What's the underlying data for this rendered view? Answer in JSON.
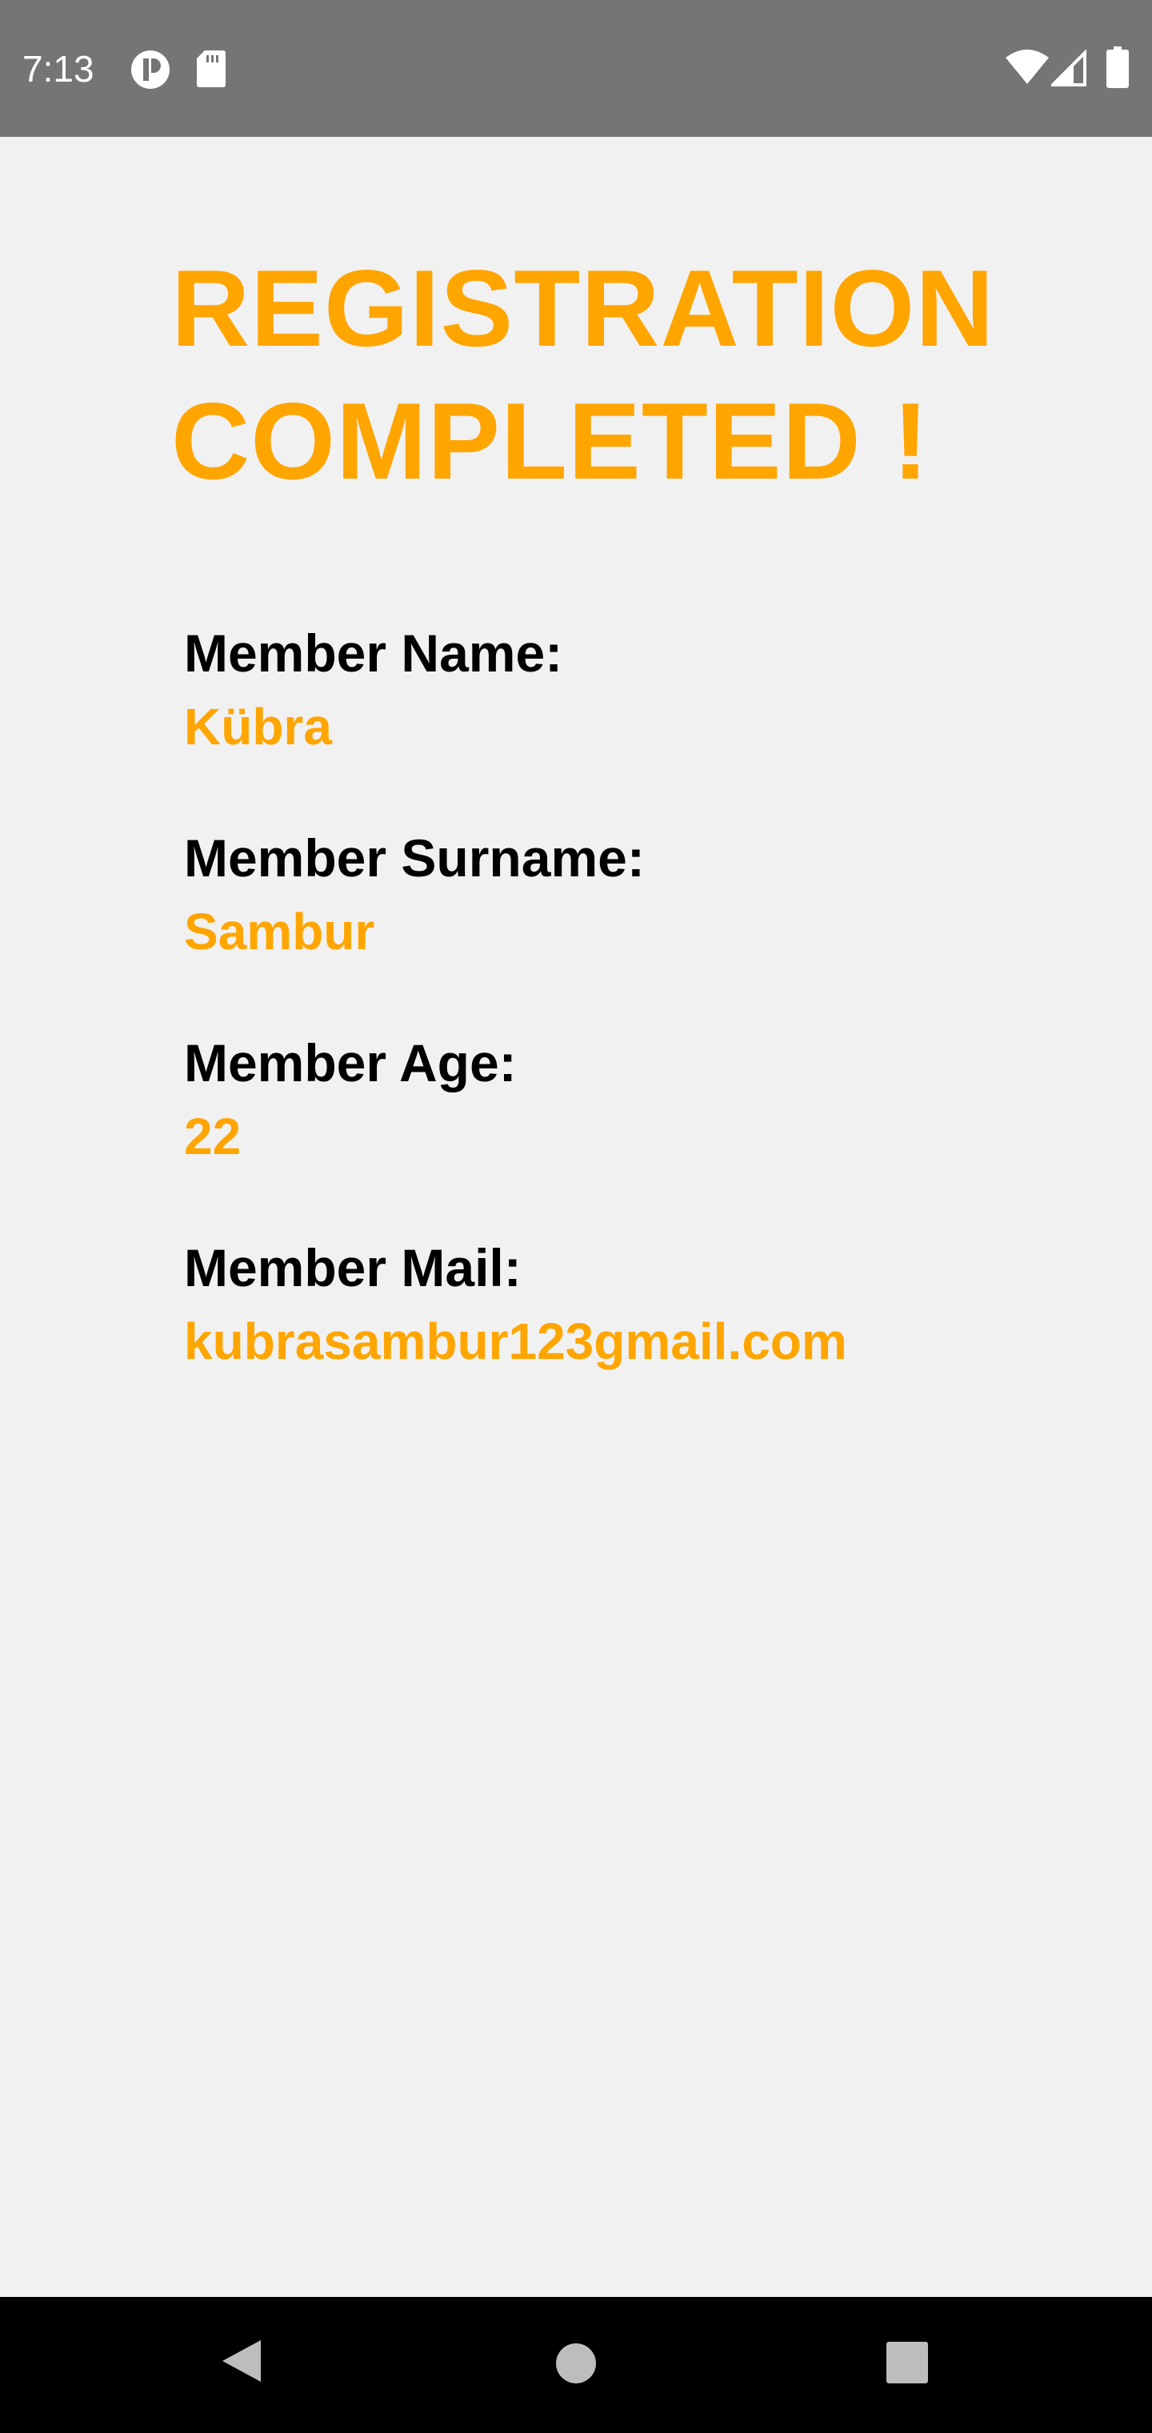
{
  "status_bar": {
    "time": "7:13",
    "icons": [
      "notification-app-icon",
      "sd-card-icon",
      "wifi-icon",
      "cell-signal-icon",
      "battery-icon"
    ]
  },
  "registration": {
    "title_line1": "REGISTRATION",
    "title_line2": "COMPLETED !",
    "fields": {
      "name": {
        "label": "Member Name:",
        "value": "Kübra"
      },
      "surname": {
        "label": "Member Surname:",
        "value": "Sambur"
      },
      "age": {
        "label": "Member Age:",
        "value": "22"
      },
      "mail": {
        "label": "Member Mail:",
        "value": "kubrasambur123gmail.com"
      }
    }
  },
  "nav_bar": {
    "buttons": [
      "back-icon",
      "home-icon",
      "recents-icon"
    ]
  },
  "colors": {
    "accent": "#ffa500",
    "status_bar": "#757575",
    "background": "#f1f1f1",
    "nav_bar": "#000000",
    "label_text": "#000000"
  }
}
